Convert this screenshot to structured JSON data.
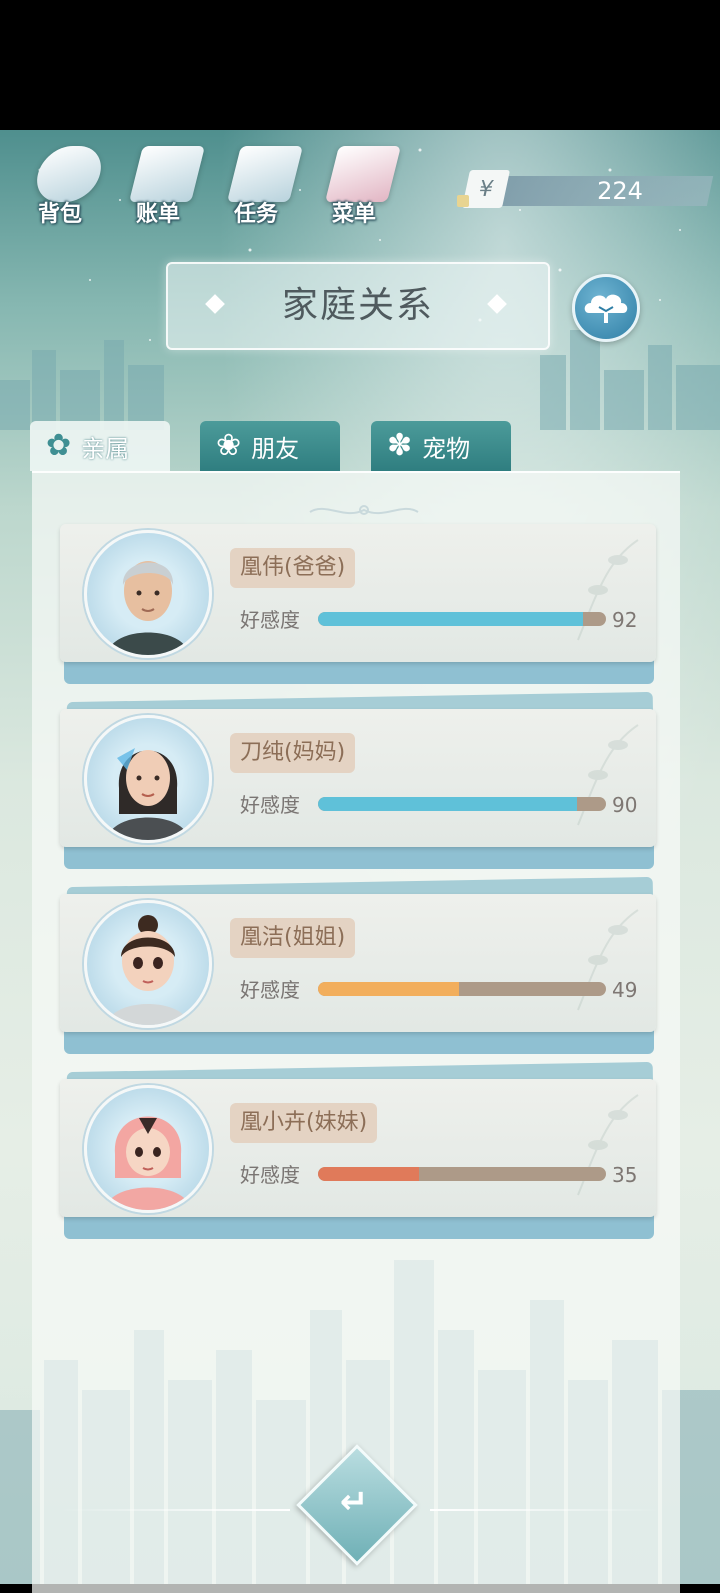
{
  "menu": {
    "items": [
      {
        "label": "背包",
        "icon": "bag-icon"
      },
      {
        "label": "账单",
        "icon": "bill-icon"
      },
      {
        "label": "任务",
        "icon": "task-icon"
      },
      {
        "label": "菜单",
        "icon": "menu-icon"
      }
    ]
  },
  "currency": {
    "symbol": "¥",
    "value": "224"
  },
  "title": "家庭关系",
  "tabs": [
    {
      "label": "亲属",
      "active": true
    },
    {
      "label": "朋友",
      "active": false
    },
    {
      "label": "宠物",
      "active": false
    }
  ],
  "relations": [
    {
      "name": "凰伟(爸爸)",
      "affinity_label": "好感度",
      "affinity": 92,
      "bar_color": "#5fc1d9"
    },
    {
      "name": "刀纯(妈妈)",
      "affinity_label": "好感度",
      "affinity": 90,
      "bar_color": "#5fc1d9"
    },
    {
      "name": "凰洁(姐姐)",
      "affinity_label": "好感度",
      "affinity": 49,
      "bar_color": "#f2ae5c"
    },
    {
      "name": "凰小卉(妹妹)",
      "affinity_label": "好感度",
      "affinity": 35,
      "bar_color": "#e07a5a"
    }
  ],
  "colors": {
    "accent": "#3f8f93",
    "chip_bg": "#e4d3c3",
    "chip_text": "#8c6e57"
  }
}
